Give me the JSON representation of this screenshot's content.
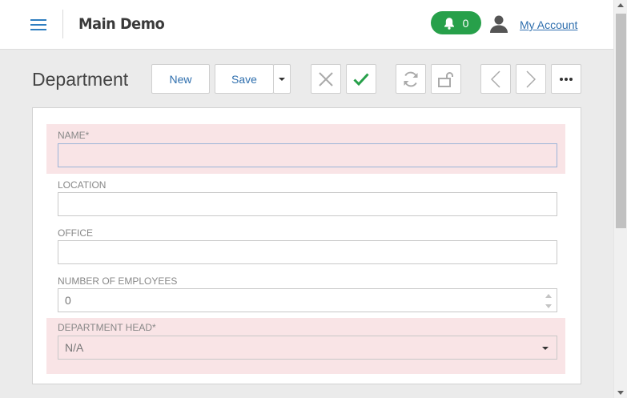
{
  "header": {
    "app_title": "Main Demo",
    "notification_count": "0",
    "account_link": "My Account"
  },
  "toolbar": {
    "page_title": "Department",
    "new_label": "New",
    "save_label": "Save"
  },
  "form": {
    "name": {
      "label": "NAME*",
      "value": ""
    },
    "location": {
      "label": "LOCATION",
      "value": ""
    },
    "office": {
      "label": "OFFICE",
      "value": ""
    },
    "employees": {
      "label": "NUMBER OF EMPLOYEES",
      "value": "0"
    },
    "department_head": {
      "label": "DEPARTMENT HEAD*",
      "value": "N/A"
    }
  },
  "colors": {
    "accent": "#2f7ec0",
    "notification_bg": "#27a04a",
    "invalid_bg": "#f9e4e6",
    "confirm_green": "#27a04a"
  }
}
